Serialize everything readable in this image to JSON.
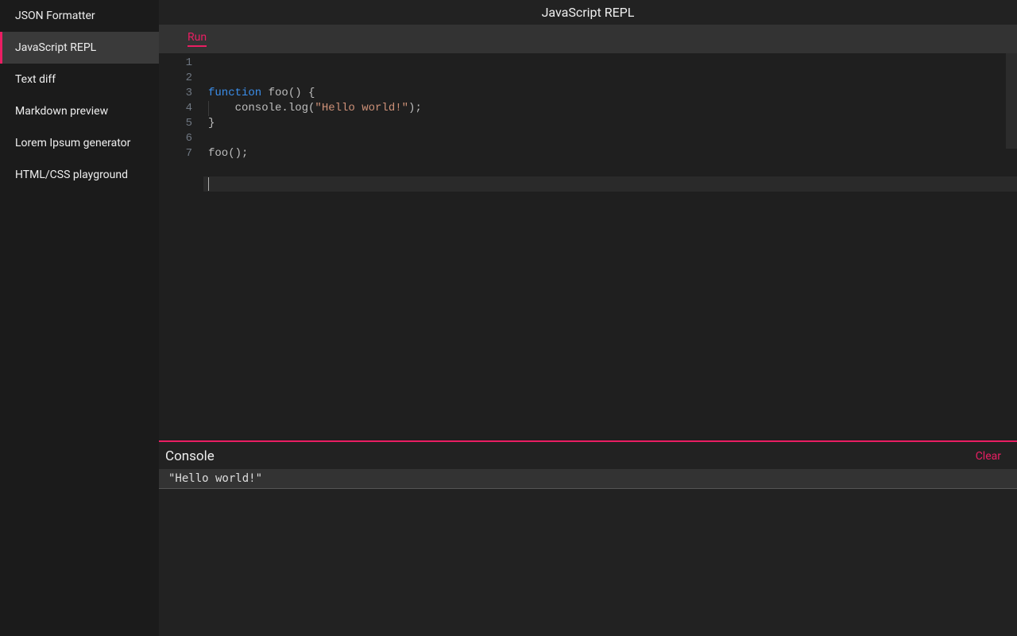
{
  "sidebar": {
    "items": [
      {
        "label": "JSON Formatter",
        "active": false
      },
      {
        "label": "JavaScript REPL",
        "active": true
      },
      {
        "label": "Text diff",
        "active": false
      },
      {
        "label": "Markdown preview",
        "active": false
      },
      {
        "label": "Lorem Ipsum generator",
        "active": false
      },
      {
        "label": "HTML/CSS playground",
        "active": false
      }
    ]
  },
  "header": {
    "title": "JavaScript REPL"
  },
  "toolbar": {
    "run_label": "Run"
  },
  "editor": {
    "line_numbers": [
      "1",
      "2",
      "3",
      "4",
      "5",
      "6",
      "7"
    ],
    "lines": [
      [
        {
          "t": "function",
          "c": "keyword"
        },
        {
          "t": " foo() {",
          "c": "default"
        }
      ],
      [
        {
          "t": "    console.log(",
          "c": "default"
        },
        {
          "t": "\"Hello world!\"",
          "c": "string"
        },
        {
          "t": ");",
          "c": "default"
        }
      ],
      [
        {
          "t": "}",
          "c": "default"
        }
      ],
      [],
      [
        {
          "t": "foo();",
          "c": "default"
        }
      ],
      [],
      []
    ],
    "current_line_index": 6
  },
  "console": {
    "title": "Console",
    "clear_label": "Clear",
    "entries": [
      "\"Hello world!\""
    ]
  }
}
